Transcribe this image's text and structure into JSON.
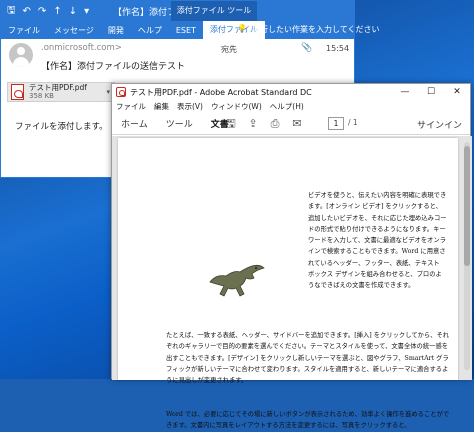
{
  "outlook": {
    "title": "【作名】添付ファイ...",
    "tool_tab": "添付ファイル ツール",
    "menu": [
      "ファイル",
      "メッセージ",
      "開発",
      "ヘルプ",
      "ESET",
      "添付ファイル"
    ],
    "active_menu_index": 5,
    "search_placeholder": "実行したい作業を入力してください",
    "sender": ".onmicrosoft.com>",
    "to_label": "宛先",
    "time": "15:54",
    "subject": "【作名】添付ファイルの送信テスト",
    "attachment": {
      "name": "テスト用PDF.pdf",
      "size": "358 KB"
    },
    "body": "ファイルを添付します。",
    "accent": "#2b78d4"
  },
  "acrobat": {
    "title": "テスト用PDF.pdf - Adobe Acrobat Standard DC",
    "menu": [
      "ファイル",
      "編集",
      "表示(V)",
      "ウィンドウ(W)",
      "ヘルプ(H)"
    ],
    "tabs": [
      "ホーム",
      "ツール",
      "文書"
    ],
    "active_tab_index": 2,
    "page_current": "1",
    "page_total": "/ 1",
    "signin": "サインイン",
    "text_right": "ビデオを使うと、伝えたい内容を明確に表現できます。[オンライン ビデオ] をクリックすると、追加したいビデオを、それに応じた埋め込みコードの形式で貼り付けできるようになります。キーワードを入力して、文書に最適なビデオをオンラインで検索することもできます。Word に用意されているヘッダー、フッター、表紙、テキスト ボックス デザインを組み合わせると、プロのようなできばえの文書を作成できます。",
    "text_full": "たとえば、一致する表紙、ヘッダー、サイドバーを追加できます。[挿入] をクリックしてから、それぞれのギャラリーで目的の要素を選んでください。テーマとスタイルを使って、文書全体の統一感を出すこともできます。[デザイン] をクリックし新しいテーマを選ぶと、図やグラフ、SmartArt グラフィックが新しいテーマに合わせて変わります。スタイルを適用すると、新しいテーマに適合するように見出しが変更されます。",
    "text_last": "Word では、必要に応じてその場に新しいボタンが表示されるため、効率よく操作を進めることができます。文書内に写真をレイアウトする方法を変更するには、写真をクリックすると、"
  }
}
